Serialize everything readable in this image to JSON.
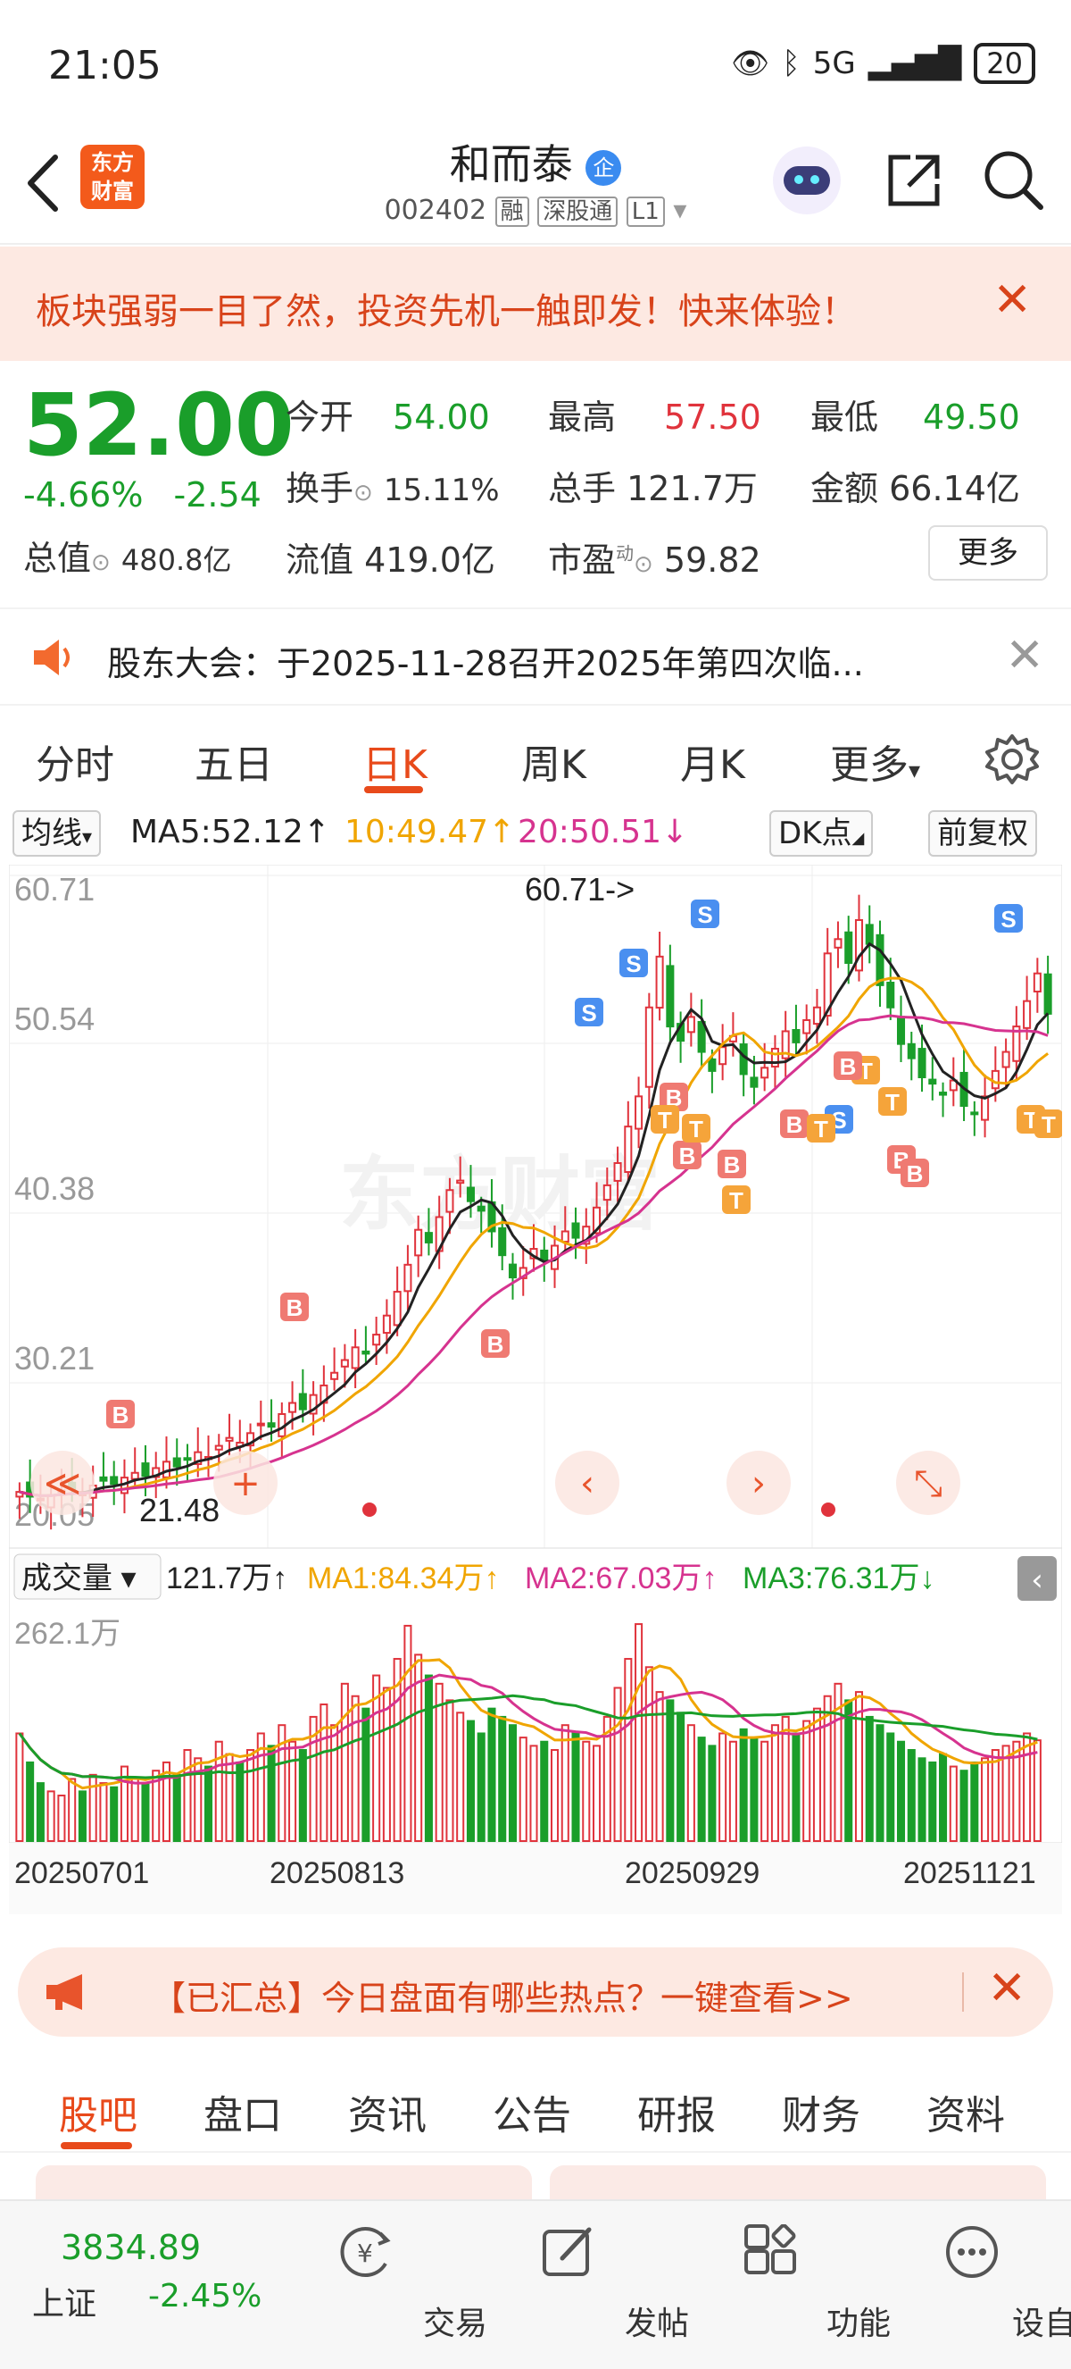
{
  "status_bar": {
    "time": "21:05",
    "network": "5G",
    "battery": "20"
  },
  "header": {
    "title": "和而泰",
    "badge": "企",
    "code": "002402",
    "tags": [
      "融",
      "深股通",
      "L1"
    ],
    "logo_line1": "东方",
    "logo_line2": "财富"
  },
  "promo": {
    "text": "板块强弱一目了然，投资先机一触即发！快来体验！"
  },
  "quote": {
    "price": "52.00",
    "change_pct": "-4.66%",
    "change": "-2.54",
    "open_label": "今开",
    "open": "54.00",
    "high_label": "最高",
    "high": "57.50",
    "low_label": "最低",
    "low": "49.50",
    "turnover_label": "换手",
    "turnover": "15.11%",
    "volume_label": "总手",
    "volume": "121.7万",
    "amount_label": "金额",
    "amount": "66.14亿",
    "mcap_label": "总值",
    "mcap": "480.8亿",
    "float_label": "流值",
    "float": "419.0亿",
    "pe_label": "市盈",
    "pe_sup": "动",
    "pe": "59.82",
    "more": "更多"
  },
  "notice": {
    "text": "股东大会：于2025-11-28召开2025年第四次临..."
  },
  "period_tabs": [
    "分时",
    "五日",
    "日K",
    "周K",
    "月K",
    "更多"
  ],
  "ma_bar": {
    "selector": "均线",
    "ma5": "MA5:52.12↑",
    "ma10": "10:49.47↑",
    "ma20": "20:50.51↓",
    "dk": "DK点",
    "adjust": "前复权"
  },
  "volume_bar": {
    "selector": "成交量",
    "vol": "121.7万↑",
    "ma1": "MA1:84.34万↑",
    "ma2": "MA2:67.03万↑",
    "ma3": "MA3:76.31万↓"
  },
  "chart_data": {
    "type": "candlestick",
    "price_axis_labels": [
      "60.71",
      "50.54",
      "40.38",
      "30.21",
      "20.05"
    ],
    "ylim": [
      20.05,
      60.71
    ],
    "max_marker": "60.71->",
    "min_marker": "21.48",
    "watermark": "东方财富",
    "date_labels": [
      "20250701",
      "20250813",
      "20250929",
      "20251121"
    ],
    "volume_axis_label": "262.1万",
    "closes": [
      21.9,
      21.6,
      21.48,
      21.7,
      22.0,
      22.1,
      21.9,
      22.3,
      22.6,
      22.4,
      22.8,
      23.1,
      22.9,
      23.4,
      23.8,
      23.5,
      24.0,
      24.4,
      24.1,
      24.8,
      25.3,
      25.0,
      25.6,
      26.2,
      26.0,
      26.8,
      27.5,
      27.1,
      28.0,
      28.6,
      29.4,
      30.2,
      31.0,
      30.6,
      31.8,
      33.0,
      34.5,
      36.2,
      38.4,
      37.6,
      39.2,
      40.9,
      41.5,
      40.2,
      39.6,
      38.3,
      36.8,
      35.4,
      36.0,
      37.2,
      36.5,
      37.4,
      38.3,
      37.9,
      38.6,
      39.8,
      41.2,
      42.6,
      44.9,
      46.8,
      52.4,
      55.6,
      51.2,
      50.3,
      51.8,
      49.6,
      48.4,
      49.9,
      50.6,
      48.2,
      47.4,
      48.6,
      49.8,
      50.9,
      50.2,
      51.6,
      52.4,
      55.8,
      56.7,
      55.2,
      57.9,
      56.4,
      53.8,
      52.4,
      50.1,
      49.2,
      48.0,
      47.6,
      46.9,
      47.8,
      46.2,
      45.7,
      46.8,
      48.4,
      49.6,
      51.2,
      52.8,
      54.54,
      52.0
    ],
    "volumes": [
      130,
      95,
      70,
      60,
      55,
      75,
      60,
      80,
      70,
      65,
      90,
      75,
      70,
      85,
      95,
      80,
      110,
      100,
      90,
      120,
      105,
      95,
      110,
      130,
      115,
      140,
      120,
      110,
      150,
      165,
      140,
      190,
      175,
      160,
      200,
      185,
      220,
      260,
      225,
      200,
      190,
      170,
      155,
      145,
      130,
      160,
      150,
      140,
      125,
      115,
      120,
      110,
      140,
      130,
      120,
      115,
      150,
      185,
      220,
      262,
      210,
      180,
      170,
      155,
      140,
      125,
      115,
      130,
      120,
      135,
      125,
      120,
      140,
      150,
      130,
      145,
      160,
      175,
      190,
      170,
      180,
      150,
      140,
      130,
      120,
      110,
      100,
      95,
      105,
      90,
      85,
      95,
      100,
      110,
      115,
      120,
      130,
      121.7
    ]
  },
  "markers": {
    "buy": "B",
    "sell": "S",
    "t": "T"
  },
  "banner2": {
    "text": "【已汇总】今日盘面有哪些热点？一键查看>>"
  },
  "sub_tabs": [
    "股吧",
    "盘口",
    "资讯",
    "公告",
    "研报",
    "财务",
    "资料"
  ],
  "bottom_nav": {
    "index_value": "3834.89",
    "index_name": "上证",
    "index_change": "-2.45%",
    "items": [
      "交易",
      "发帖",
      "功能",
      "设自选"
    ]
  },
  "colors": {
    "up": "#e0333c",
    "down": "#1a9e2a",
    "accent": "#e84a1b",
    "ma5": "#222222",
    "ma10": "#f0a500",
    "ma20": "#d6338f"
  }
}
